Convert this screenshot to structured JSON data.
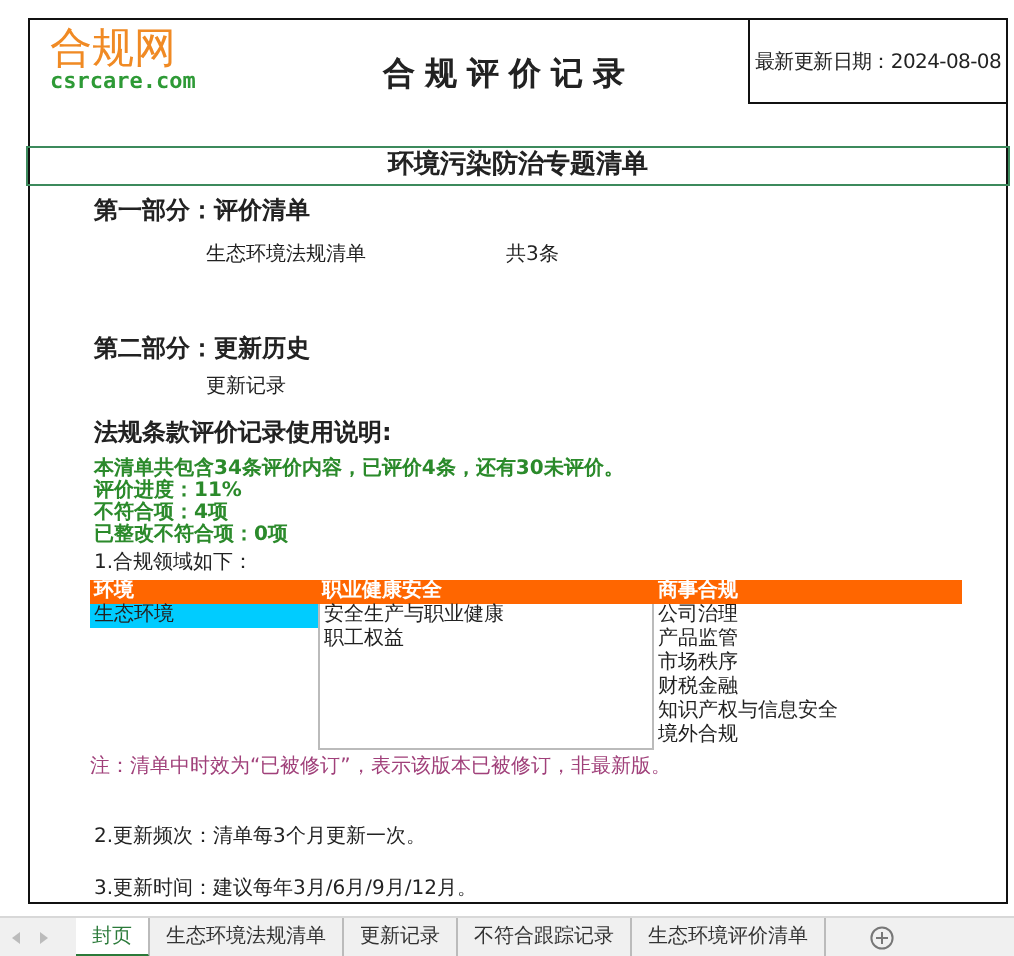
{
  "logo": {
    "name": "合规网",
    "domain": "csrcare.com"
  },
  "title": "合规评价记录",
  "updated": "最新更新日期：2024-08-08",
  "topic": "环境污染防治专题清单",
  "part1": {
    "heading": "第一部分：评价清单",
    "link": "生态环境法规清单",
    "count": "共3条"
  },
  "part2": {
    "heading": "第二部分：更新历史",
    "link": "更新记录"
  },
  "instructions": {
    "heading": "法规条款评价记录使用说明:",
    "stats": [
      "本清单共包含34条评价内容，已评价4条，还有30未评价。",
      "评价进度：11%",
      "不符合项：4项",
      "已整改不符合项：0项"
    ],
    "domains_label": "1.合规领域如下：",
    "domains": [
      {
        "name": "环境",
        "items": [
          {
            "label": "生态环境",
            "selected": true
          }
        ]
      },
      {
        "name": "职业健康安全",
        "items": [
          {
            "label": "安全生产与职业健康",
            "selected": false
          },
          {
            "label": "职工权益",
            "selected": false
          }
        ]
      },
      {
        "name": "商事合规",
        "items": [
          {
            "label": "公司治理",
            "selected": false
          },
          {
            "label": "产品监管",
            "selected": false
          },
          {
            "label": "市场秩序",
            "selected": false
          },
          {
            "label": "财税金融",
            "selected": false
          },
          {
            "label": "知识产权与信息安全",
            "selected": false
          },
          {
            "label": "境外合规",
            "selected": false
          }
        ]
      }
    ],
    "note": "注：清单中时效为“已被修订”，表示该版本已被修订，非最新版。",
    "frequency": "2.更新频次：清单每3个月更新一次。",
    "timing": "3.更新时间：建议每年3月/6月/9月/12月。"
  },
  "sheet_tabs": [
    {
      "label": "封页",
      "selected": true
    },
    {
      "label": "生态环境法规清单",
      "selected": false
    },
    {
      "label": "更新记录",
      "selected": false
    },
    {
      "label": "不符合跟踪记录",
      "selected": false
    },
    {
      "label": "生态环境评价清单",
      "selected": false
    }
  ]
}
